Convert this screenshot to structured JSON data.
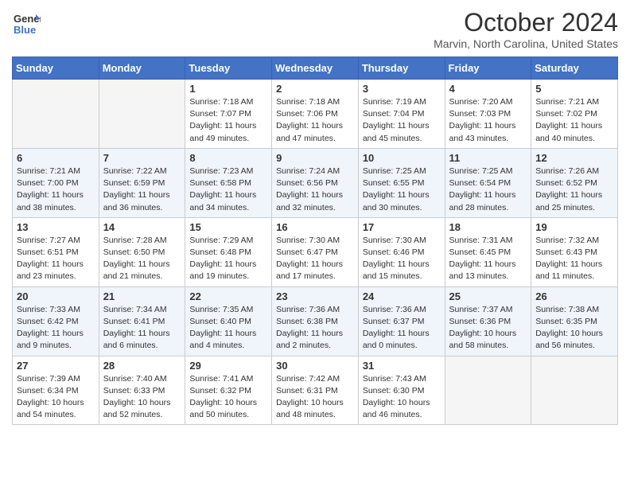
{
  "header": {
    "logo_line1": "General",
    "logo_line2": "Blue",
    "month": "October 2024",
    "location": "Marvin, North Carolina, United States"
  },
  "weekdays": [
    "Sunday",
    "Monday",
    "Tuesday",
    "Wednesday",
    "Thursday",
    "Friday",
    "Saturday"
  ],
  "weeks": [
    [
      {
        "day": "",
        "sunrise": "",
        "sunset": "",
        "daylight": "",
        "empty": true
      },
      {
        "day": "",
        "sunrise": "",
        "sunset": "",
        "daylight": "",
        "empty": true
      },
      {
        "day": "1",
        "sunrise": "Sunrise: 7:18 AM",
        "sunset": "Sunset: 7:07 PM",
        "daylight": "Daylight: 11 hours and 49 minutes.",
        "empty": false
      },
      {
        "day": "2",
        "sunrise": "Sunrise: 7:18 AM",
        "sunset": "Sunset: 7:06 PM",
        "daylight": "Daylight: 11 hours and 47 minutes.",
        "empty": false
      },
      {
        "day": "3",
        "sunrise": "Sunrise: 7:19 AM",
        "sunset": "Sunset: 7:04 PM",
        "daylight": "Daylight: 11 hours and 45 minutes.",
        "empty": false
      },
      {
        "day": "4",
        "sunrise": "Sunrise: 7:20 AM",
        "sunset": "Sunset: 7:03 PM",
        "daylight": "Daylight: 11 hours and 43 minutes.",
        "empty": false
      },
      {
        "day": "5",
        "sunrise": "Sunrise: 7:21 AM",
        "sunset": "Sunset: 7:02 PM",
        "daylight": "Daylight: 11 hours and 40 minutes.",
        "empty": false
      }
    ],
    [
      {
        "day": "6",
        "sunrise": "Sunrise: 7:21 AM",
        "sunset": "Sunset: 7:00 PM",
        "daylight": "Daylight: 11 hours and 38 minutes.",
        "empty": false
      },
      {
        "day": "7",
        "sunrise": "Sunrise: 7:22 AM",
        "sunset": "Sunset: 6:59 PM",
        "daylight": "Daylight: 11 hours and 36 minutes.",
        "empty": false
      },
      {
        "day": "8",
        "sunrise": "Sunrise: 7:23 AM",
        "sunset": "Sunset: 6:58 PM",
        "daylight": "Daylight: 11 hours and 34 minutes.",
        "empty": false
      },
      {
        "day": "9",
        "sunrise": "Sunrise: 7:24 AM",
        "sunset": "Sunset: 6:56 PM",
        "daylight": "Daylight: 11 hours and 32 minutes.",
        "empty": false
      },
      {
        "day": "10",
        "sunrise": "Sunrise: 7:25 AM",
        "sunset": "Sunset: 6:55 PM",
        "daylight": "Daylight: 11 hours and 30 minutes.",
        "empty": false
      },
      {
        "day": "11",
        "sunrise": "Sunrise: 7:25 AM",
        "sunset": "Sunset: 6:54 PM",
        "daylight": "Daylight: 11 hours and 28 minutes.",
        "empty": false
      },
      {
        "day": "12",
        "sunrise": "Sunrise: 7:26 AM",
        "sunset": "Sunset: 6:52 PM",
        "daylight": "Daylight: 11 hours and 25 minutes.",
        "empty": false
      }
    ],
    [
      {
        "day": "13",
        "sunrise": "Sunrise: 7:27 AM",
        "sunset": "Sunset: 6:51 PM",
        "daylight": "Daylight: 11 hours and 23 minutes.",
        "empty": false
      },
      {
        "day": "14",
        "sunrise": "Sunrise: 7:28 AM",
        "sunset": "Sunset: 6:50 PM",
        "daylight": "Daylight: 11 hours and 21 minutes.",
        "empty": false
      },
      {
        "day": "15",
        "sunrise": "Sunrise: 7:29 AM",
        "sunset": "Sunset: 6:48 PM",
        "daylight": "Daylight: 11 hours and 19 minutes.",
        "empty": false
      },
      {
        "day": "16",
        "sunrise": "Sunrise: 7:30 AM",
        "sunset": "Sunset: 6:47 PM",
        "daylight": "Daylight: 11 hours and 17 minutes.",
        "empty": false
      },
      {
        "day": "17",
        "sunrise": "Sunrise: 7:30 AM",
        "sunset": "Sunset: 6:46 PM",
        "daylight": "Daylight: 11 hours and 15 minutes.",
        "empty": false
      },
      {
        "day": "18",
        "sunrise": "Sunrise: 7:31 AM",
        "sunset": "Sunset: 6:45 PM",
        "daylight": "Daylight: 11 hours and 13 minutes.",
        "empty": false
      },
      {
        "day": "19",
        "sunrise": "Sunrise: 7:32 AM",
        "sunset": "Sunset: 6:43 PM",
        "daylight": "Daylight: 11 hours and 11 minutes.",
        "empty": false
      }
    ],
    [
      {
        "day": "20",
        "sunrise": "Sunrise: 7:33 AM",
        "sunset": "Sunset: 6:42 PM",
        "daylight": "Daylight: 11 hours and 9 minutes.",
        "empty": false
      },
      {
        "day": "21",
        "sunrise": "Sunrise: 7:34 AM",
        "sunset": "Sunset: 6:41 PM",
        "daylight": "Daylight: 11 hours and 6 minutes.",
        "empty": false
      },
      {
        "day": "22",
        "sunrise": "Sunrise: 7:35 AM",
        "sunset": "Sunset: 6:40 PM",
        "daylight": "Daylight: 11 hours and 4 minutes.",
        "empty": false
      },
      {
        "day": "23",
        "sunrise": "Sunrise: 7:36 AM",
        "sunset": "Sunset: 6:38 PM",
        "daylight": "Daylight: 11 hours and 2 minutes.",
        "empty": false
      },
      {
        "day": "24",
        "sunrise": "Sunrise: 7:36 AM",
        "sunset": "Sunset: 6:37 PM",
        "daylight": "Daylight: 11 hours and 0 minutes.",
        "empty": false
      },
      {
        "day": "25",
        "sunrise": "Sunrise: 7:37 AM",
        "sunset": "Sunset: 6:36 PM",
        "daylight": "Daylight: 10 hours and 58 minutes.",
        "empty": false
      },
      {
        "day": "26",
        "sunrise": "Sunrise: 7:38 AM",
        "sunset": "Sunset: 6:35 PM",
        "daylight": "Daylight: 10 hours and 56 minutes.",
        "empty": false
      }
    ],
    [
      {
        "day": "27",
        "sunrise": "Sunrise: 7:39 AM",
        "sunset": "Sunset: 6:34 PM",
        "daylight": "Daylight: 10 hours and 54 minutes.",
        "empty": false
      },
      {
        "day": "28",
        "sunrise": "Sunrise: 7:40 AM",
        "sunset": "Sunset: 6:33 PM",
        "daylight": "Daylight: 10 hours and 52 minutes.",
        "empty": false
      },
      {
        "day": "29",
        "sunrise": "Sunrise: 7:41 AM",
        "sunset": "Sunset: 6:32 PM",
        "daylight": "Daylight: 10 hours and 50 minutes.",
        "empty": false
      },
      {
        "day": "30",
        "sunrise": "Sunrise: 7:42 AM",
        "sunset": "Sunset: 6:31 PM",
        "daylight": "Daylight: 10 hours and 48 minutes.",
        "empty": false
      },
      {
        "day": "31",
        "sunrise": "Sunrise: 7:43 AM",
        "sunset": "Sunset: 6:30 PM",
        "daylight": "Daylight: 10 hours and 46 minutes.",
        "empty": false
      },
      {
        "day": "",
        "sunrise": "",
        "sunset": "",
        "daylight": "",
        "empty": true
      },
      {
        "day": "",
        "sunrise": "",
        "sunset": "",
        "daylight": "",
        "empty": true
      }
    ]
  ]
}
